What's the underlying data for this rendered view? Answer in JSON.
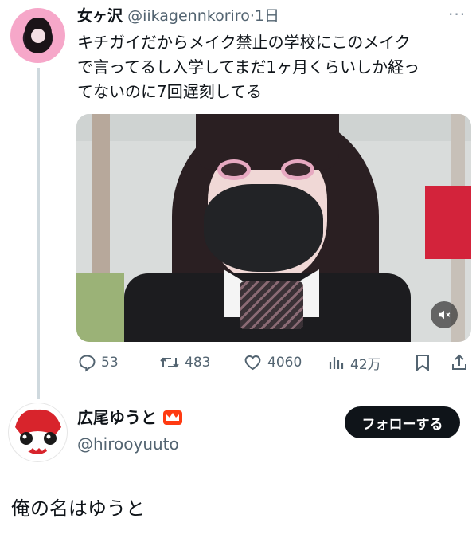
{
  "tweet": {
    "name": "女ヶ沢",
    "handle": "@iikagennkoriro",
    "separator": "·",
    "time": "1日",
    "text_lines": [
      "キチガイだからメイク禁止の学校にこのメイク",
      "で言ってるし入学してまだ1ヶ月くらいしか経っ",
      "てないのに7回遅刻してる"
    ],
    "more_label": "···",
    "media": {
      "type": "video",
      "mute_icon": "mute-icon"
    }
  },
  "actions": {
    "replies": "53",
    "retweets": "483",
    "likes": "4060",
    "views": "42万"
  },
  "reply_post": {
    "name": "広尾ゆうと",
    "badge_icon": "crown-icon",
    "handle": "@hirooyuuto",
    "follow_label": "フォローする",
    "text": "俺の名はゆうと"
  },
  "colors": {
    "text": "#0f1419",
    "secondary": "#536471",
    "thread_line": "#cfd9de",
    "button_bg": "#0f1419",
    "crown": "#ff3b12"
  }
}
